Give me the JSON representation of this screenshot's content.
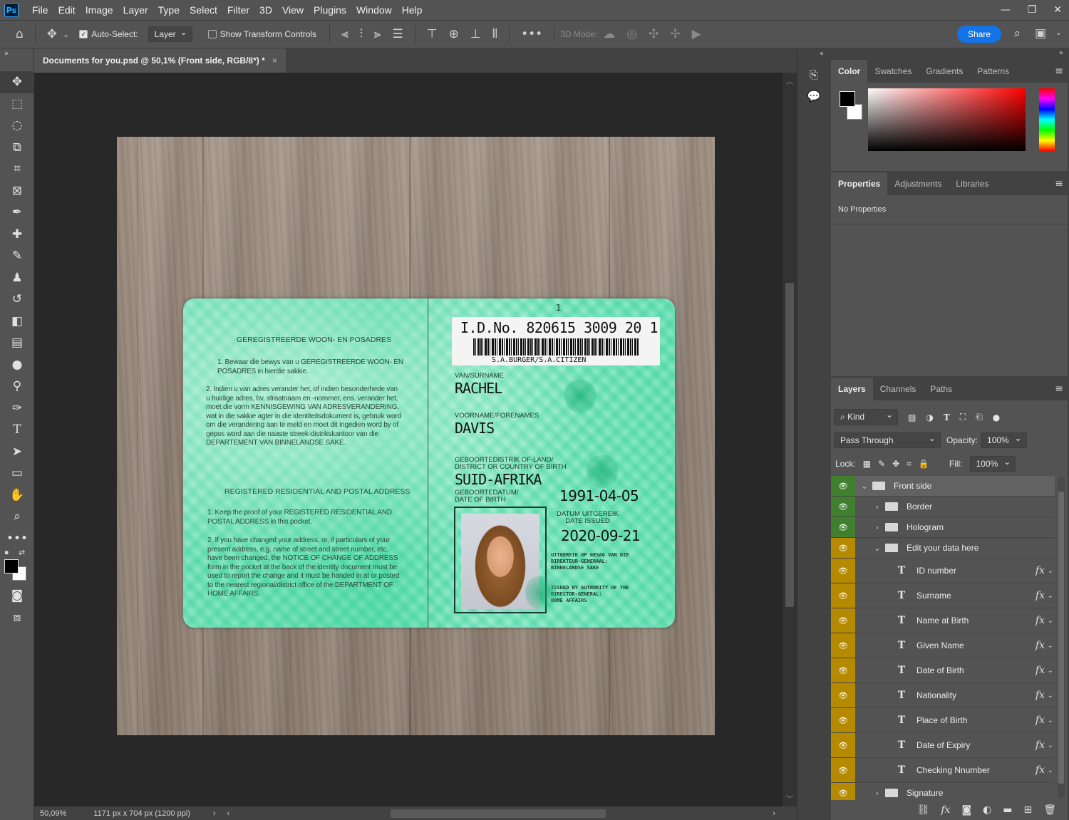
{
  "menubar": {
    "logo": "Ps",
    "items": [
      "File",
      "Edit",
      "Image",
      "Layer",
      "Type",
      "Select",
      "Filter",
      "3D",
      "View",
      "Plugins",
      "Window",
      "Help"
    ],
    "minimize": "—",
    "restore": "❐",
    "close": "✕"
  },
  "options": {
    "auto_select_label": "Auto-Select:",
    "auto_select_target": "Layer",
    "show_transform_label": "Show Transform Controls",
    "mode_3d_label": "3D Mode:",
    "share_label": "Share"
  },
  "document": {
    "tab_title": "Documents for you.psd @ 50,1% (Front side, RGB/8*) *",
    "close_glyph": "×"
  },
  "status": {
    "zoom": "50,09%",
    "dimensions": "1171 px x 704 px (1200 ppi)",
    "arrow": "›",
    "left_arrow": "‹",
    "right_arrow": "›"
  },
  "card": {
    "page_number": "1",
    "id_number": "I.D.No. 820615  3009 20  1",
    "citizen": "S.A.BURGER/S.A.CITIZEN",
    "surname_label": "VAN/SURNAME",
    "surname": "RACHEL",
    "forenames_label": "VOORNAME/FORENAMES",
    "forenames": "DAVIS",
    "birth_place_label": "GEBOORTEDISTRIK OF-LAND/\nDISTRICT OR COUNTRY OF BIRTH",
    "birth_place": "SUID-AFRIKA",
    "dob_label": "GEBOORTEDATUM/\nDATE OF BIRTH",
    "dob": "1991-04-05",
    "issued_label": "DATUM UITGEREIK\nDATE ISSUED",
    "issued": "2020-09-21",
    "issued_by_af": "UITGEREIK OP GESAG VAN DIE\nDIREKTEUR-GENERAAL:\nBINNELANDSE SAKE",
    "issued_by_en": "ISSUED BY AUTHORITY OF THE\nDIRECTOR-GENERAL:\nHOME AFFAIRS",
    "left_heading_af": "GEREGISTREERDE WOON- EN POSADRES",
    "left_para1": "1. Bewaar die bewys van u GEREGISTREERDE WOON- EN POSADRES in hierdie sakkie.",
    "left_para2": "2. Indien u van adres verander het, of indien besonderhede van u huidige adres, bv. straatnaam en -nommer, ens. verander het, moet die vorm KENNISGEWING VAN ADRESVERANDERING, wat in die sakkie agter in die identiteitsdokument is, gebruik word om die verandering aan te meld en moet dit ingedien word by of gepos word aan die naaste streek-distrikskantoor van die DEPARTEMENT VAN BINNELANDSE SAKE.",
    "left_heading_en": "REGISTERED RESIDENTIAL AND POSTAL ADDRESS",
    "left_para3": "1. Keep the proof of your REGISTERED RESIDENTIAL AND POSTAL ADDRESS in this pocket.",
    "left_para4": "2. If you have changed your address, or, if particulars of your present address, e.g. name of street and street number, etc. have been changed, the NOTICE OF CHANGE OF ADDRESS form in the pocket at the back of the identity document must be used to report the change and it must be handed in at or posted to the nearest regional/district office of the DEPARTMENT OF HOME AFFAIRS."
  },
  "color_panel": {
    "tabs": [
      "Color",
      "Swatches",
      "Gradients",
      "Patterns"
    ]
  },
  "properties_panel": {
    "tabs": [
      "Properties",
      "Adjustments",
      "Libraries"
    ],
    "empty_text": "No Properties"
  },
  "layers_panel": {
    "tabs": [
      "Layers",
      "Channels",
      "Paths"
    ],
    "kind_label": "Kind",
    "blend_mode": "Pass Through",
    "opacity_label": "Opacity:",
    "opacity_value": "100%",
    "lock_label": "Lock:",
    "fill_label": "Fill:",
    "fill_value": "100%",
    "layers": [
      {
        "name": "Front side",
        "type": "group",
        "level": 0,
        "expanded": true,
        "eye": "green"
      },
      {
        "name": "Border",
        "type": "group",
        "level": 1,
        "expanded": false,
        "eye": "green"
      },
      {
        "name": "Hologram",
        "type": "group",
        "level": 1,
        "expanded": false,
        "eye": "green"
      },
      {
        "name": "Edit your data here",
        "type": "group",
        "level": 1,
        "expanded": true,
        "eye": "yellow"
      },
      {
        "name": "ID number",
        "type": "text",
        "level": 2,
        "eye": "yellow"
      },
      {
        "name": "Surname",
        "type": "text",
        "level": 2,
        "eye": "yellow"
      },
      {
        "name": "Name at Birth",
        "type": "text",
        "level": 2,
        "eye": "yellow"
      },
      {
        "name": "Given Name",
        "type": "text",
        "level": 2,
        "eye": "yellow"
      },
      {
        "name": "Date of Birth",
        "type": "text",
        "level": 2,
        "eye": "yellow"
      },
      {
        "name": "Nationality",
        "type": "text",
        "level": 2,
        "eye": "yellow"
      },
      {
        "name": "Place of Birth",
        "type": "text",
        "level": 2,
        "eye": "yellow"
      },
      {
        "name": "Date of Expiry",
        "type": "text",
        "level": 2,
        "eye": "yellow"
      },
      {
        "name": "Checking Nnumber",
        "type": "text",
        "level": 2,
        "eye": "yellow"
      },
      {
        "name": "Signature",
        "type": "group",
        "level": 1,
        "expanded": false,
        "eye": "yellow"
      }
    ]
  }
}
